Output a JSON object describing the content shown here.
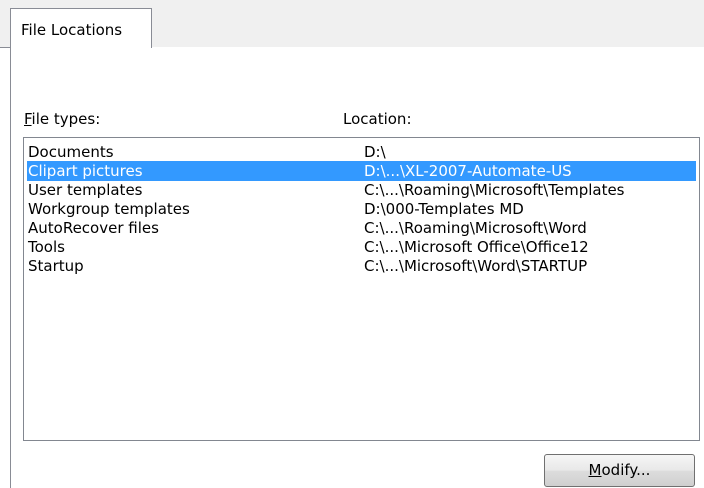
{
  "tab": {
    "label": "File Locations"
  },
  "list": {
    "header_types": "File types:",
    "header_types_access_key": "F",
    "header_types_rest": "ile types:",
    "header_location": "Location:",
    "rows": [
      {
        "type": "Documents",
        "location": "D:\\",
        "selected": false
      },
      {
        "type": "Clipart pictures",
        "location": "D:\\...\\XL-2007-Automate-US",
        "selected": true
      },
      {
        "type": "User templates",
        "location": "C:\\...\\Roaming\\Microsoft\\Templates",
        "selected": false
      },
      {
        "type": "Workgroup templates",
        "location": "D:\\000-Templates MD",
        "selected": false
      },
      {
        "type": "AutoRecover files",
        "location": "C:\\...\\Roaming\\Microsoft\\Word",
        "selected": false
      },
      {
        "type": "Tools",
        "location": "C:\\...\\Microsoft Office\\Office12",
        "selected": false
      },
      {
        "type": "Startup",
        "location": "C:\\...\\Microsoft\\Word\\STARTUP",
        "selected": false
      }
    ]
  },
  "buttons": {
    "modify_label": "Modify...",
    "modify_access_key": "M",
    "modify_rest": "odify..."
  },
  "colors": {
    "selection": "#3399ff",
    "border": "#898c95"
  }
}
